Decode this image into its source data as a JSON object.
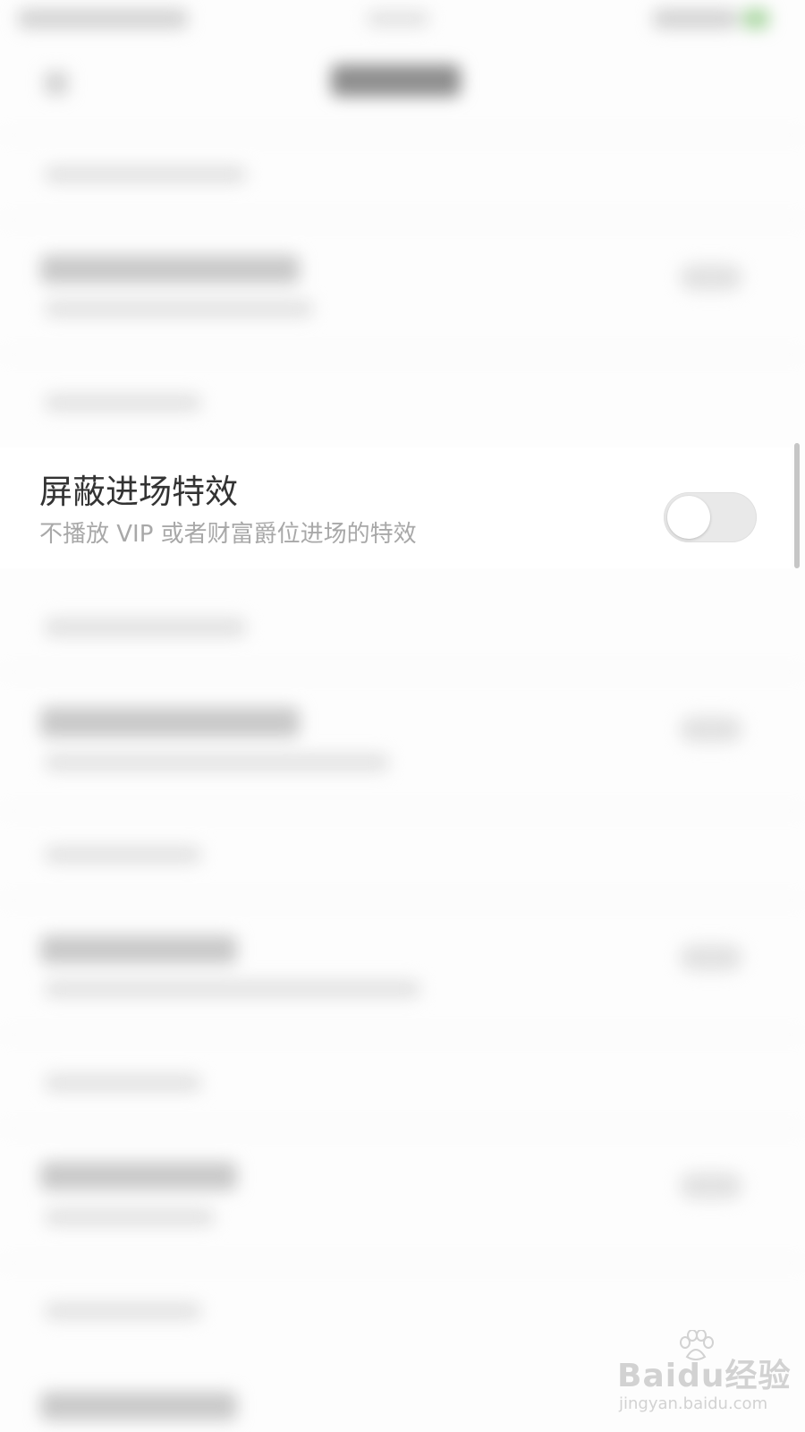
{
  "setting": {
    "title": "屏蔽进场特效",
    "description": "不播放 VIP 或者财富爵位进场的特效",
    "enabled": false
  },
  "watermark": {
    "logo": "Baidu经验",
    "url": "jingyan.baidu.com"
  },
  "colors": {
    "title_text": "#333333",
    "description_text": "#a8a8a8",
    "toggle_off_track": "#e9e9e9"
  }
}
